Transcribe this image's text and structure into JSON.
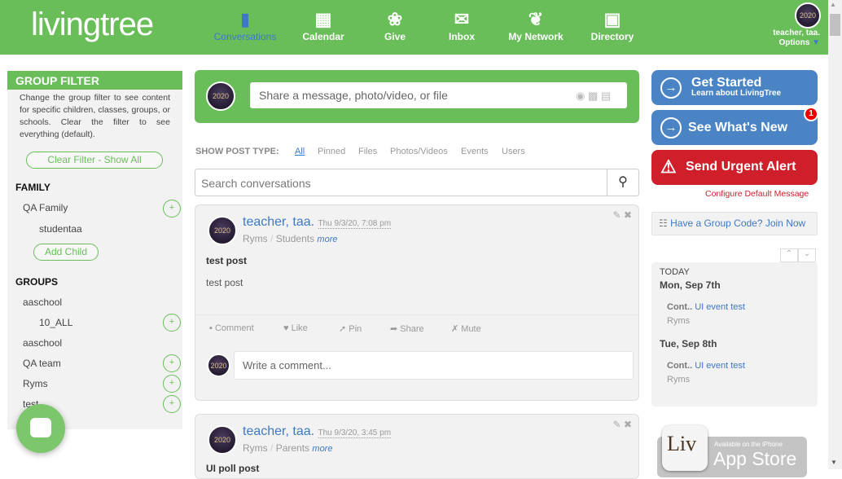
{
  "header": {
    "logo": "livingtree",
    "nav": [
      {
        "label": "Conversations",
        "icon": "chat-icon"
      },
      {
        "label": "Calendar",
        "icon": "calendar-icon"
      },
      {
        "label": "Give",
        "icon": "plant-hand-icon"
      },
      {
        "label": "Inbox",
        "icon": "envelope-icon"
      },
      {
        "label": "My Network",
        "icon": "leaf-icon"
      },
      {
        "label": "Directory",
        "icon": "contacts-icon"
      }
    ],
    "user": "teacher, taa.",
    "options": "Options",
    "avatar_text": "2020"
  },
  "sidebar": {
    "title": "GROUP FILTER",
    "description": "Change the group filter to see content for specific children, classes, groups, or schools. Clear the filter to see everything (default).",
    "clear": "Clear Filter - Show All",
    "family_title": "FAMILY",
    "family": "QA Family",
    "child": "studentaa",
    "add_child": "Add Child",
    "groups_title": "GROUPS",
    "groups": [
      "aaschool",
      "10_ALL",
      "aaschool",
      "QA team",
      "Ryms",
      "test"
    ],
    "plus": "+"
  },
  "share": {
    "placeholder": "Share a message, photo/video, or file"
  },
  "filter": {
    "label": "SHOW POST TYPE:",
    "types": [
      "All",
      "Pinned",
      "Files",
      "Photos/Videos",
      "Events",
      "Users"
    ]
  },
  "search": {
    "placeholder": "Search conversations"
  },
  "posts": [
    {
      "author": "teacher, taa.",
      "date": "Thu 9/3/20, 7:08 pm",
      "group": "Ryms",
      "sep": "/",
      "audience": "Students",
      "more": "more",
      "title": "test post",
      "body": "test post",
      "actions": [
        "Comment",
        "Like",
        "Pin",
        "Share",
        "Mute"
      ],
      "comment_placeholder": "Write a comment..."
    },
    {
      "author": "teacher, taa.",
      "date": "Thu 9/3/20, 3:45 pm",
      "group": "Ryms",
      "sep": "/",
      "audience": "Parents",
      "more": "more",
      "title": "UI poll post"
    }
  ],
  "right": {
    "get_started": "Get Started",
    "get_started_sub": "Learn about LivingTree",
    "whats_new": "See What's New",
    "badge": "1",
    "urgent": "Send Urgent Alert",
    "configure": "Configure Default Message",
    "group_code": "Have a Group Code? Join Now",
    "calendar": {
      "today": "TODAY",
      "days": [
        {
          "date": "Mon, Sep 7th",
          "prefix": "Cont..",
          "event": "UI event test",
          "group": "Ryms"
        },
        {
          "date": "Tue, Sep 8th",
          "prefix": "Cont..",
          "event": "UI event test",
          "group": "Ryms"
        }
      ]
    },
    "appstore_small": "Available on the iPhone",
    "appstore": "App Store",
    "appstore_logo": "Liv"
  }
}
